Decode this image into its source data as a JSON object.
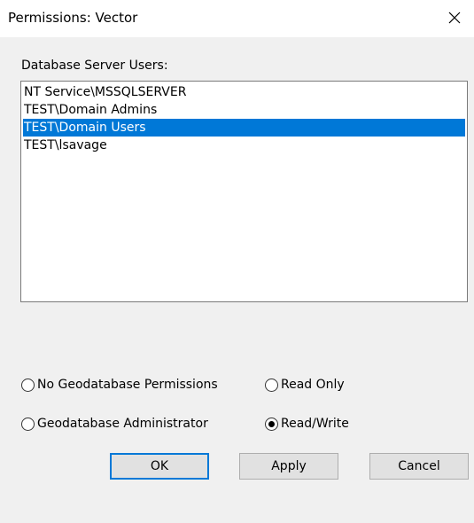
{
  "window": {
    "title": "Permissions: Vector"
  },
  "users_list": {
    "label": "Database Server Users:",
    "items": [
      {
        "label": "NT Service\\MSSQLSERVER",
        "selected": false
      },
      {
        "label": "TEST\\Domain Admins",
        "selected": false
      },
      {
        "label": "TEST\\Domain Users",
        "selected": true
      },
      {
        "label": "TEST\\lsavage",
        "selected": false
      }
    ]
  },
  "permissions": {
    "options": [
      {
        "label": "No Geodatabase Permissions",
        "checked": false
      },
      {
        "label": "Read Only",
        "checked": false
      },
      {
        "label": "Geodatabase Administrator",
        "checked": false
      },
      {
        "label": "Read/Write",
        "checked": true
      }
    ]
  },
  "buttons": {
    "ok": "OK",
    "apply": "Apply",
    "cancel": "Cancel"
  },
  "icons": {
    "close": "close-icon",
    "radio": "radio-icon"
  },
  "colors": {
    "selection_background": "#0078d7",
    "dialog_background": "#f0f0f0",
    "default_button_border": "#0078d7"
  }
}
